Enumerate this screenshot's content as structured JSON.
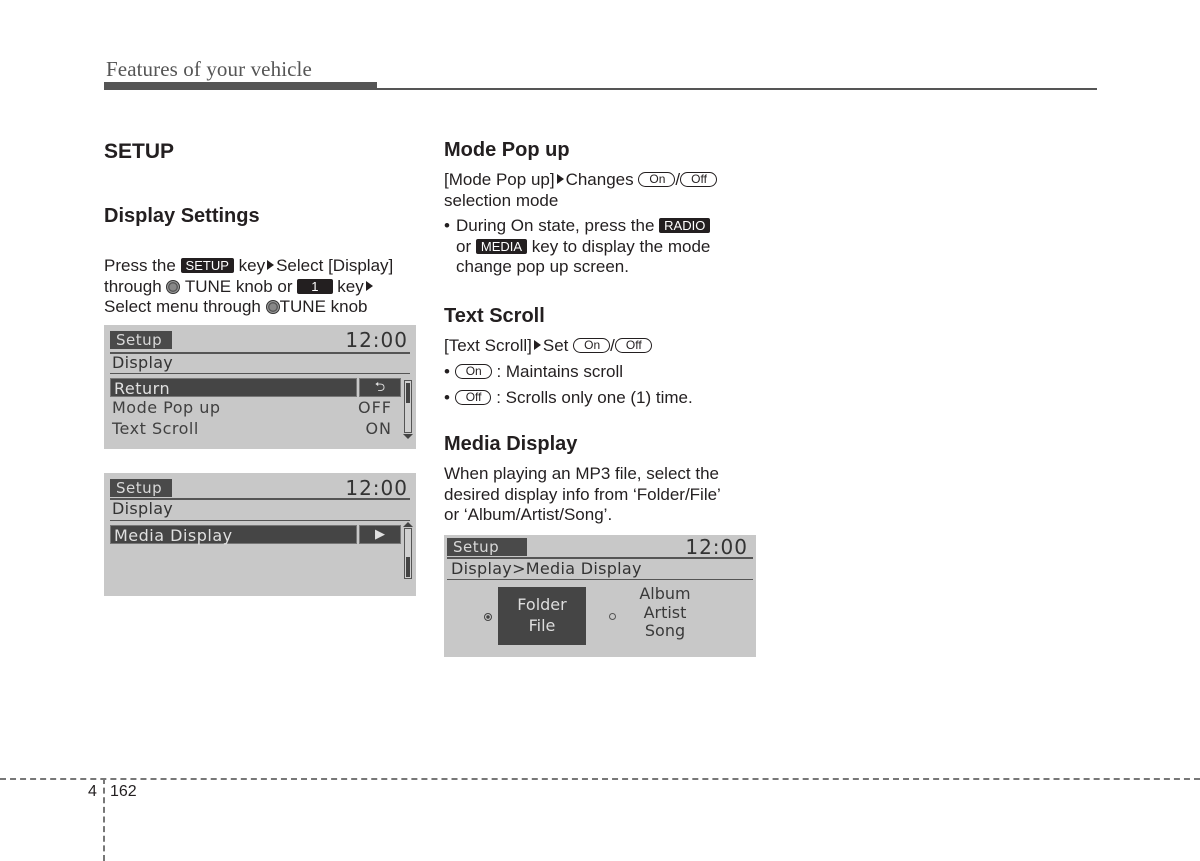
{
  "header": {
    "title": "Features of your vehicle"
  },
  "left": {
    "section_title": "SETUP",
    "subsection_title": "Display Settings",
    "instructions": {
      "line1_a": "Press the",
      "setup_key": "SETUP",
      "line1_b": "key",
      "line1_c": "Select [Display]",
      "line2_a": "through",
      "line2_b": "TUNE knob or",
      "num_key": "1",
      "line2_c": "key",
      "line3_a": "Select menu through",
      "line3_b": "TUNE knob"
    },
    "screen1": {
      "tab": "Setup",
      "time": "12:00",
      "subtitle": "Display",
      "selected_row": "Return",
      "selected_icon": "return-icon",
      "rows": [
        {
          "label": "Mode Pop up",
          "value": "OFF"
        },
        {
          "label": "Text Scroll",
          "value": "ON"
        }
      ]
    },
    "screen2": {
      "tab": "Setup",
      "time": "12:00",
      "subtitle": "Display",
      "selected_row": "Media Display",
      "selected_icon": "arrow-right-icon"
    }
  },
  "right": {
    "mode_popup": {
      "title": "Mode Pop up",
      "line1_a": "[Mode Pop up]",
      "line1_b": "Changes",
      "on": "On",
      "sep": "/",
      "off": "Off",
      "line2": "selection mode",
      "bullet_a": "During On state, press the",
      "radio_key": "RADIO",
      "bullet_b": "or",
      "media_key": "MEDIA",
      "bullet_c": "key to display the mode",
      "bullet_d": "change pop up screen."
    },
    "text_scroll": {
      "title": "Text Scroll",
      "line1_a": "[Text Scroll]",
      "line1_b": "Set",
      "on": "On",
      "sep": "/",
      "off": "Off",
      "bullet1_desc": ": Maintains scroll",
      "bullet2_desc": ": Scrolls only one (1) time."
    },
    "media_display": {
      "title": "Media Display",
      "line1": "When playing an MP3 file, select the",
      "line2": "desired display info from ‘Folder/File’",
      "line3": "or ‘Album/Artist/Song’."
    },
    "screen3": {
      "tab": "Setup",
      "time": "12:00",
      "breadcrumb": "Display>Media Display",
      "option1": {
        "line1": "Folder",
        "line2": "File",
        "selected": true
      },
      "option2": {
        "line1": "Album",
        "line2": "Artist",
        "line3": "Song",
        "selected": false
      }
    }
  },
  "footer": {
    "chapter": "4",
    "page": "162"
  },
  "colors": {
    "text": "#231f20",
    "lcd_bg": "#c8c8c8",
    "lcd_dark": "#454545",
    "rule": "#555555"
  }
}
